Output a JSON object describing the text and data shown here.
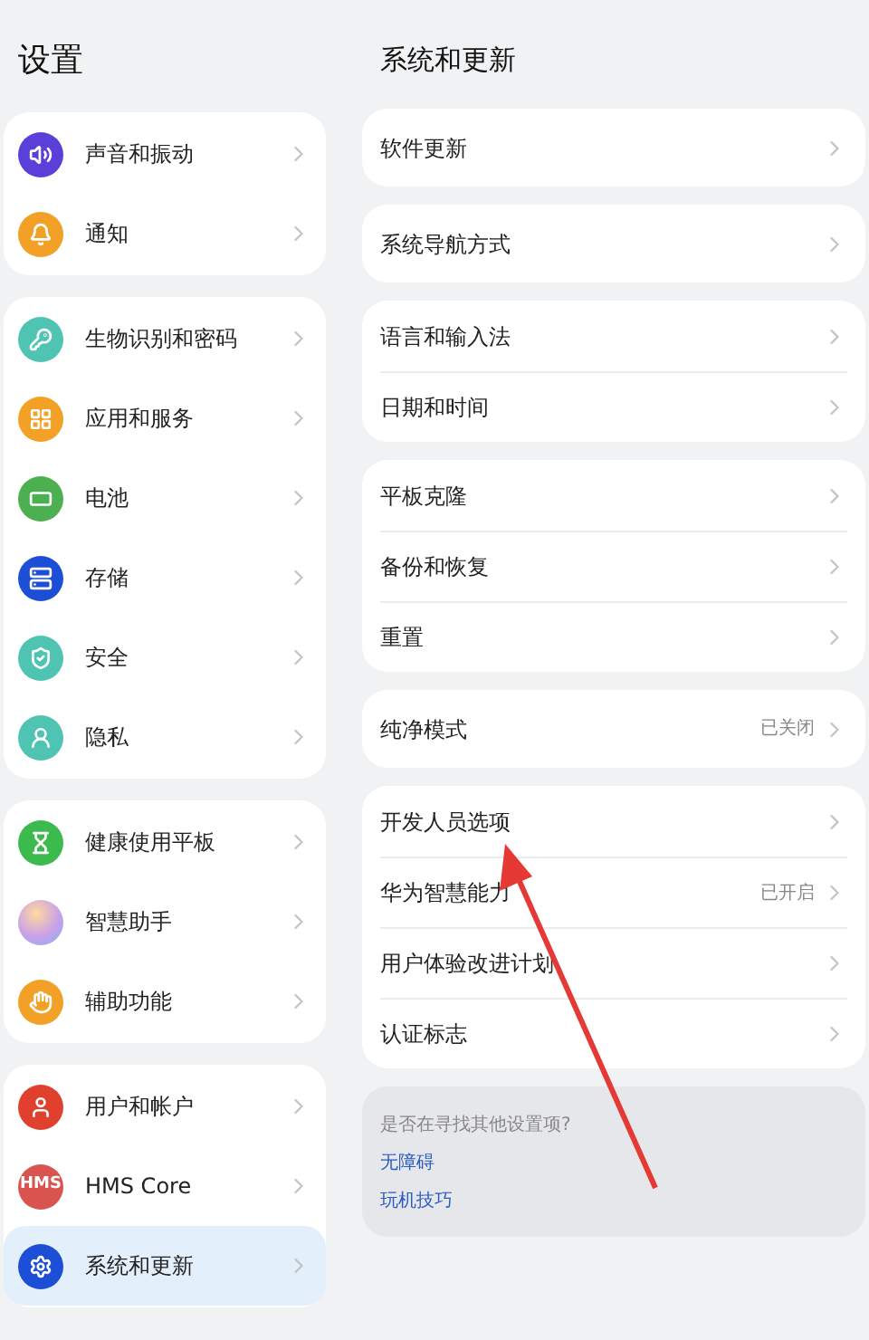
{
  "sidebar": {
    "title": "设置",
    "groups": [
      [
        {
          "label": "声音和振动",
          "kind": "sound",
          "color": "#5b3fd9",
          "selected": false
        },
        {
          "label": "通知",
          "kind": "bell",
          "color": "#f2a126",
          "selected": false
        }
      ],
      [
        {
          "label": "生物识别和密码",
          "kind": "key",
          "color": "#4fc4b2",
          "selected": false
        },
        {
          "label": "应用和服务",
          "kind": "apps",
          "color": "#f2a126",
          "selected": false
        },
        {
          "label": "电池",
          "kind": "battery",
          "color": "#4caf50",
          "selected": false
        },
        {
          "label": "存储",
          "kind": "storage",
          "color": "#1d4fd6",
          "selected": false
        },
        {
          "label": "安全",
          "kind": "shield",
          "color": "#4fc4b2",
          "selected": false
        },
        {
          "label": "隐私",
          "kind": "privacy",
          "color": "#4fc4b2",
          "selected": false
        }
      ],
      [
        {
          "label": "健康使用平板",
          "kind": "hourglass",
          "color": "#3dba4e",
          "selected": false
        },
        {
          "label": "智慧助手",
          "kind": "assistant",
          "color": "#c9a0e8",
          "selected": false
        },
        {
          "label": "辅助功能",
          "kind": "hand",
          "color": "#f2a126",
          "selected": false
        }
      ],
      [
        {
          "label": "用户和帐户",
          "kind": "user",
          "color": "#e0402e",
          "selected": false
        },
        {
          "label": "HMS Core",
          "kind": "text",
          "icon_text": "HMS",
          "color": "#d9534f",
          "selected": false
        },
        {
          "label": "系统和更新",
          "kind": "gear",
          "color": "#1d4fd6",
          "selected": true
        }
      ]
    ]
  },
  "detail": {
    "title": "系统和更新",
    "groups": [
      [
        {
          "label": "软件更新"
        }
      ],
      [
        {
          "label": "系统导航方式"
        }
      ],
      [
        {
          "label": "语言和输入法"
        },
        {
          "label": "日期和时间"
        }
      ],
      [
        {
          "label": "平板克隆"
        },
        {
          "label": "备份和恢复"
        },
        {
          "label": "重置"
        }
      ],
      [
        {
          "label": "纯净模式",
          "value": "已关闭"
        }
      ],
      [
        {
          "label": "开发人员选项"
        },
        {
          "label": "华为智慧能力",
          "value": "已开启"
        },
        {
          "label": "用户体验改进计划"
        },
        {
          "label": "认证标志"
        }
      ]
    ],
    "suggestions": {
      "prompt": "是否在寻找其他设置项?",
      "links": [
        "无障碍",
        "玩机技巧"
      ]
    }
  }
}
